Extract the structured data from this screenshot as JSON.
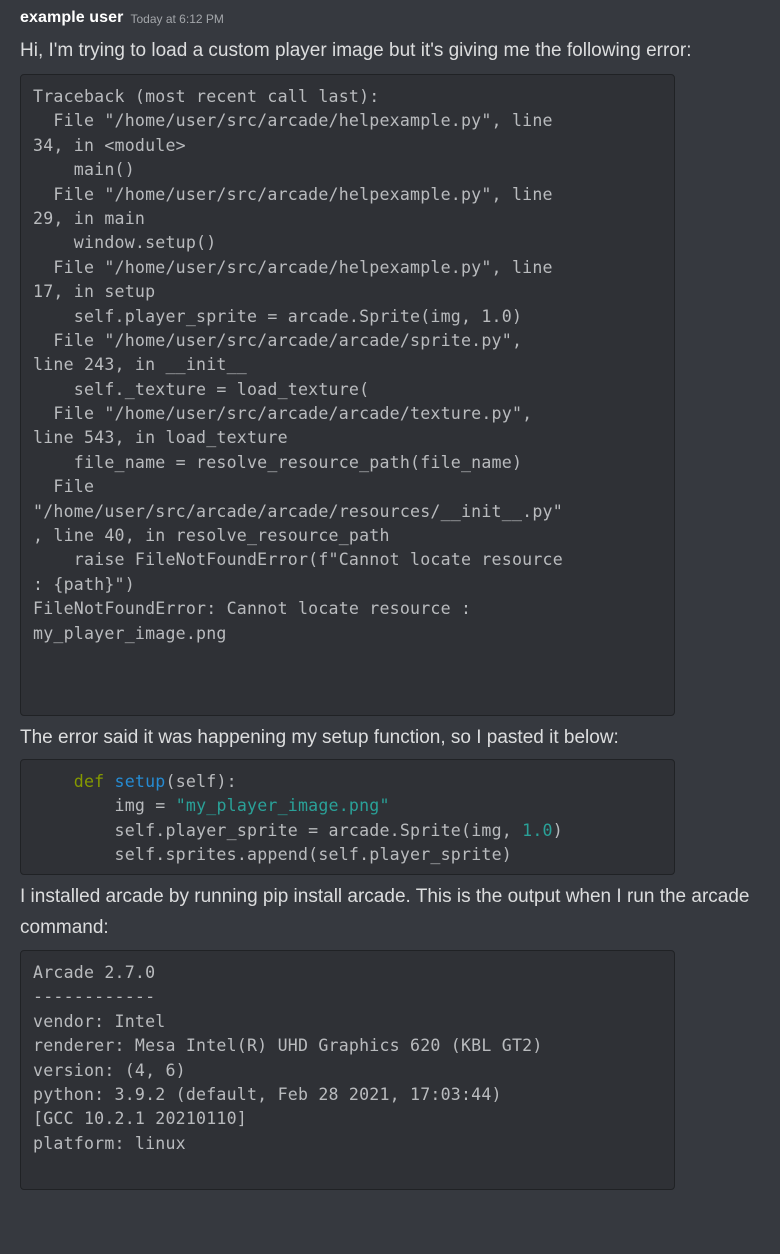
{
  "message": {
    "username": "example user",
    "timestamp": "Today at 6:12 PM",
    "paragraph1": "Hi, I'm trying to load a custom player image but it's giving me the following error:",
    "traceback_lines": [
      "Traceback (most recent call last):",
      "  File \"/home/user/src/arcade/helpexample.py\", line",
      "34, in <module>",
      "    main()",
      "  File \"/home/user/src/arcade/helpexample.py\", line",
      "29, in main",
      "    window.setup()",
      "  File \"/home/user/src/arcade/helpexample.py\", line",
      "17, in setup",
      "    self.player_sprite = arcade.Sprite(img, 1.0)",
      "  File \"/home/user/src/arcade/arcade/sprite.py\",",
      "line 243, in __init__",
      "    self._texture = load_texture(",
      "  File \"/home/user/src/arcade/arcade/texture.py\",",
      "line 543, in load_texture",
      "    file_name = resolve_resource_path(file_name)",
      "  File",
      "\"/home/user/src/arcade/arcade/resources/__init__.py\"",
      ", line 40, in resolve_resource_path",
      "    raise FileNotFoundError(f\"Cannot locate resource",
      ": {path}\")",
      "FileNotFoundError: Cannot locate resource :",
      "my_player_image.png"
    ],
    "paragraph2": "The error said it was happening my setup function, so I pasted it below:",
    "code": {
      "indent1": "    ",
      "kw_def": "def",
      "fn_setup": "setup",
      "sig_rest": "(self):",
      "indent2": "        ",
      "img_assign": "img = ",
      "img_str": "\"my_player_image.png\"",
      "sprite_pre": "self.player_sprite = arcade.Sprite(img, ",
      "sprite_num": "1.0",
      "sprite_post": ")",
      "append_line": "self.sprites.append(self.player_sprite)"
    },
    "paragraph3": "I installed arcade by running pip install arcade. This is the output when I run the arcade command:",
    "output_lines": [
      "Arcade 2.7.0",
      "------------",
      "vendor: Intel",
      "renderer: Mesa Intel(R) UHD Graphics 620 (KBL GT2)",
      "version: (4, 6)",
      "python: 3.9.2 (default, Feb 28 2021, 17:03:44)",
      "[GCC 10.2.1 20210110]",
      "platform: linux"
    ]
  },
  "colors": {
    "background": "#36393f",
    "code_background": "#2f3136",
    "keyword": "#859900",
    "function": "#268bd2",
    "string": "#2aa198"
  }
}
